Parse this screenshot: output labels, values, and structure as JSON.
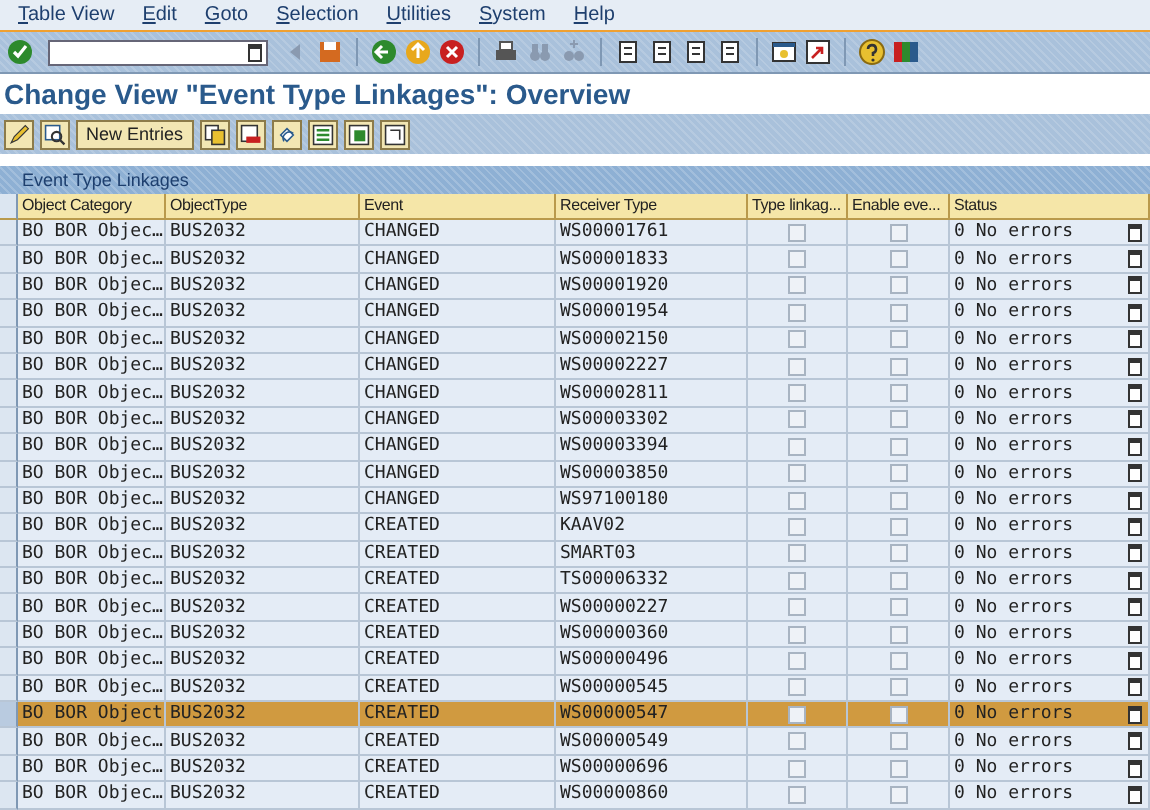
{
  "menu": [
    "Table View",
    "Edit",
    "Goto",
    "Selection",
    "Utilities",
    "System",
    "Help"
  ],
  "title": "Change View \"Event Type Linkages\": Overview",
  "app_toolbar": {
    "new_entries": "New Entries"
  },
  "table": {
    "title": "Event Type Linkages",
    "columns": [
      "Object Category",
      "ObjectType",
      "Event",
      "Receiver Type",
      "Type linkag...",
      "Enable eve...",
      "Status"
    ],
    "rows": [
      {
        "category": "BO BOR Objec…",
        "object_type": "BUS2032",
        "event": "CHANGED",
        "receiver": "WS00001761",
        "type_linkage": false,
        "enable_event": false,
        "status": "0 No errors",
        "selected": false
      },
      {
        "category": "BO BOR Objec…",
        "object_type": "BUS2032",
        "event": "CHANGED",
        "receiver": "WS00001833",
        "type_linkage": false,
        "enable_event": false,
        "status": "0 No errors",
        "selected": false
      },
      {
        "category": "BO BOR Objec…",
        "object_type": "BUS2032",
        "event": "CHANGED",
        "receiver": "WS00001920",
        "type_linkage": false,
        "enable_event": false,
        "status": "0 No errors",
        "selected": false
      },
      {
        "category": "BO BOR Objec…",
        "object_type": "BUS2032",
        "event": "CHANGED",
        "receiver": "WS00001954",
        "type_linkage": false,
        "enable_event": false,
        "status": "0 No errors",
        "selected": false
      },
      {
        "category": "BO BOR Objec…",
        "object_type": "BUS2032",
        "event": "CHANGED",
        "receiver": "WS00002150",
        "type_linkage": false,
        "enable_event": false,
        "status": "0 No errors",
        "selected": false
      },
      {
        "category": "BO BOR Objec…",
        "object_type": "BUS2032",
        "event": "CHANGED",
        "receiver": "WS00002227",
        "type_linkage": false,
        "enable_event": false,
        "status": "0 No errors",
        "selected": false
      },
      {
        "category": "BO BOR Objec…",
        "object_type": "BUS2032",
        "event": "CHANGED",
        "receiver": "WS00002811",
        "type_linkage": false,
        "enable_event": false,
        "status": "0 No errors",
        "selected": false
      },
      {
        "category": "BO BOR Objec…",
        "object_type": "BUS2032",
        "event": "CHANGED",
        "receiver": "WS00003302",
        "type_linkage": false,
        "enable_event": false,
        "status": "0 No errors",
        "selected": false
      },
      {
        "category": "BO BOR Objec…",
        "object_type": "BUS2032",
        "event": "CHANGED",
        "receiver": "WS00003394",
        "type_linkage": false,
        "enable_event": false,
        "status": "0 No errors",
        "selected": false
      },
      {
        "category": "BO BOR Objec…",
        "object_type": "BUS2032",
        "event": "CHANGED",
        "receiver": "WS00003850",
        "type_linkage": false,
        "enable_event": false,
        "status": "0 No errors",
        "selected": false
      },
      {
        "category": "BO BOR Objec…",
        "object_type": "BUS2032",
        "event": "CHANGED",
        "receiver": "WS97100180",
        "type_linkage": false,
        "enable_event": false,
        "status": "0 No errors",
        "selected": false
      },
      {
        "category": "BO BOR Objec…",
        "object_type": "BUS2032",
        "event": "CREATED",
        "receiver": "KAAV02",
        "type_linkage": false,
        "enable_event": false,
        "status": "0 No errors",
        "selected": false
      },
      {
        "category": "BO BOR Objec…",
        "object_type": "BUS2032",
        "event": "CREATED",
        "receiver": "SMART03",
        "type_linkage": false,
        "enable_event": false,
        "status": "0 No errors",
        "selected": false
      },
      {
        "category": "BO BOR Objec…",
        "object_type": "BUS2032",
        "event": "CREATED",
        "receiver": "TS00006332",
        "type_linkage": false,
        "enable_event": false,
        "status": "0 No errors",
        "selected": false
      },
      {
        "category": "BO BOR Objec…",
        "object_type": "BUS2032",
        "event": "CREATED",
        "receiver": "WS00000227",
        "type_linkage": false,
        "enable_event": false,
        "status": "0 No errors",
        "selected": false
      },
      {
        "category": "BO BOR Objec…",
        "object_type": "BUS2032",
        "event": "CREATED",
        "receiver": "WS00000360",
        "type_linkage": false,
        "enable_event": false,
        "status": "0 No errors",
        "selected": false
      },
      {
        "category": "BO BOR Objec…",
        "object_type": "BUS2032",
        "event": "CREATED",
        "receiver": "WS00000496",
        "type_linkage": false,
        "enable_event": false,
        "status": "0 No errors",
        "selected": false
      },
      {
        "category": "BO BOR Objec…",
        "object_type": "BUS2032",
        "event": "CREATED",
        "receiver": "WS00000545",
        "type_linkage": false,
        "enable_event": false,
        "status": "0 No errors",
        "selected": false
      },
      {
        "category": "BO BOR Object",
        "object_type": "BUS2032",
        "event": "CREATED",
        "receiver": "WS00000547",
        "type_linkage": false,
        "enable_event": false,
        "status": "0 No errors",
        "selected": true
      },
      {
        "category": "BO BOR Objec…",
        "object_type": "BUS2032",
        "event": "CREATED",
        "receiver": "WS00000549",
        "type_linkage": false,
        "enable_event": false,
        "status": "0 No errors",
        "selected": false
      },
      {
        "category": "BO BOR Objec…",
        "object_type": "BUS2032",
        "event": "CREATED",
        "receiver": "WS00000696",
        "type_linkage": false,
        "enable_event": false,
        "status": "0 No errors",
        "selected": false
      },
      {
        "category": "BO BOR Objec…",
        "object_type": "BUS2032",
        "event": "CREATED",
        "receiver": "WS00000860",
        "type_linkage": false,
        "enable_event": false,
        "status": "0 No errors",
        "selected": false
      }
    ]
  }
}
